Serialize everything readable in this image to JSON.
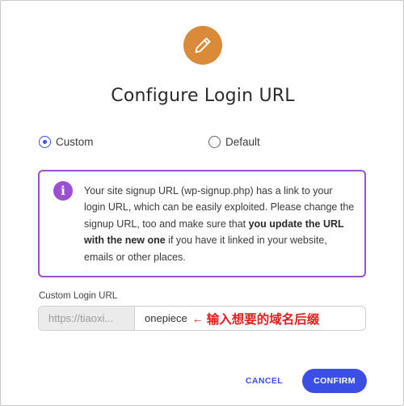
{
  "dialog": {
    "title": "Configure Login URL",
    "icon": "pencil-icon",
    "badge_color": "#d98b3a"
  },
  "options": {
    "custom_label": "Custom",
    "default_label": "Default",
    "selected": "Custom"
  },
  "notice": {
    "icon": "info-icon",
    "icon_glyph": "i",
    "accent_color": "#9b4fd2",
    "text_before": "Your site signup URL (wp-signup.php) has a link to your login URL, which can be easily exploited. Please change the signup URL, too and make sure that ",
    "text_bold": "you update the URL with the new one",
    "text_after": " if you have it linked in your website, emails or other places."
  },
  "custom_login": {
    "label": "Custom Login URL",
    "prefix": "https://tiaoxi...",
    "value": "onepiece",
    "annotation_arrow": "←",
    "annotation": "输入想要的域名后缀"
  },
  "actions": {
    "cancel_label": "CANCEL",
    "confirm_label": "CONFIRM",
    "primary_color": "#3b4fe4"
  }
}
